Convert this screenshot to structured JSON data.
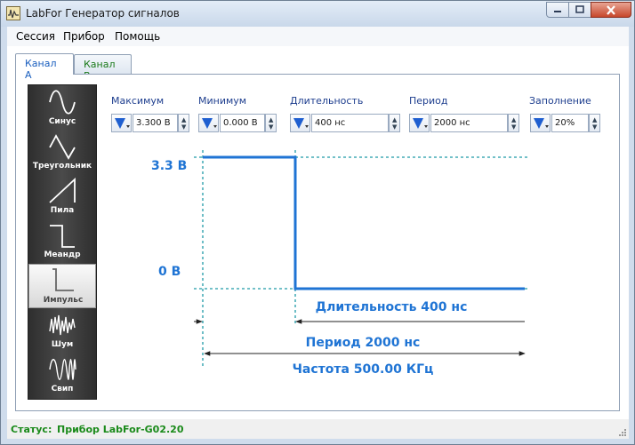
{
  "window": {
    "title": "LabFor Генератор сигналов",
    "icon": "oscilloscope-icon"
  },
  "menu": [
    "Сессия",
    "Прибор",
    "Помощь"
  ],
  "tabs": [
    {
      "label": "Канал А",
      "active": true
    },
    {
      "label": "Канал B",
      "active": false
    }
  ],
  "waveforms": [
    {
      "label": "Синус",
      "icon": "sine-wave-icon"
    },
    {
      "label": "Треугольник",
      "icon": "triangle-wave-icon"
    },
    {
      "label": "Пила",
      "icon": "sawtooth-wave-icon"
    },
    {
      "label": "Меандр",
      "icon": "square-wave-icon"
    },
    {
      "label": "Импульс",
      "icon": "pulse-wave-icon",
      "selected": true
    },
    {
      "label": "Шум",
      "icon": "noise-wave-icon"
    },
    {
      "label": "Свип",
      "icon": "sweep-wave-icon"
    }
  ],
  "params": {
    "max": {
      "label": "Максимум",
      "value": "3.300 В"
    },
    "min": {
      "label": "Минимум",
      "value": "0.000 В"
    },
    "width": {
      "label": "Длительность",
      "value": "400 нс"
    },
    "period": {
      "label": "Период",
      "value": "2000 нс"
    },
    "duty": {
      "label": "Заполнение",
      "value": "20%"
    }
  },
  "graph": {
    "high_label": "3.3 В",
    "low_label": "0 В",
    "width_label": "Длительность 400 нс",
    "period_label": "Период 2000 нс",
    "frequency_label": "Частота 500.00 КГц",
    "accent": "#1f74d4"
  },
  "status": {
    "label": "Статус:",
    "value": "Прибор LabFor-G02.20"
  }
}
